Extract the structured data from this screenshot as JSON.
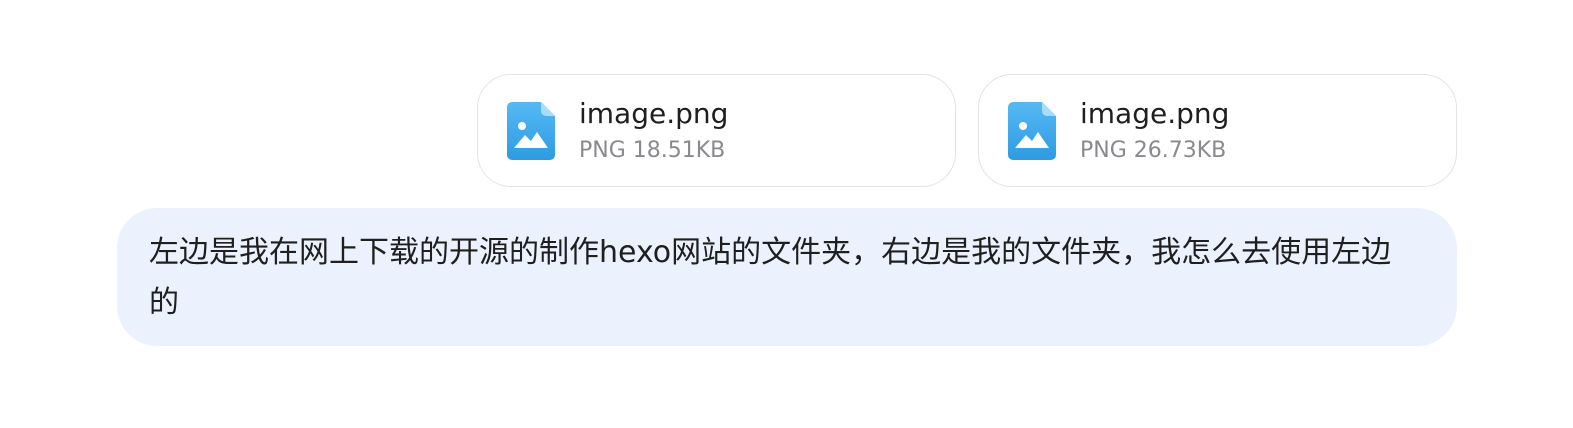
{
  "attachments": [
    {
      "name": "image.png",
      "meta": "PNG 18.51KB",
      "icon": "image-file-icon"
    },
    {
      "name": "image.png",
      "meta": "PNG 26.73KB",
      "icon": "image-file-icon"
    }
  ],
  "message": {
    "text": "左边是我在网上下载的开源的制作hexo网站的文件夹，右边是我的文件夹，我怎么去使用左边的"
  },
  "colors": {
    "bubble_background": "#ecf2fd",
    "card_border": "#e3e3e6",
    "icon_blue": "#3ba8ee",
    "meta_text": "#8a8a8e"
  }
}
